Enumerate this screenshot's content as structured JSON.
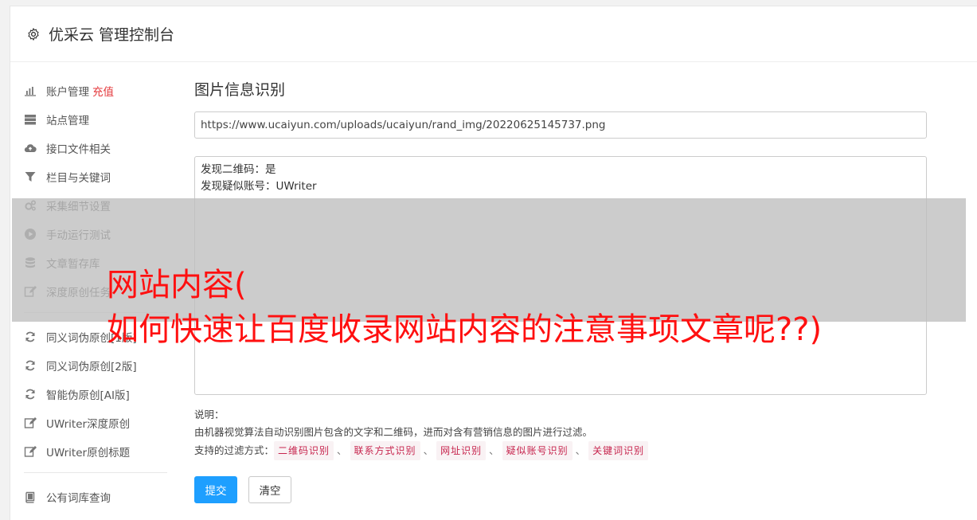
{
  "header": {
    "title": "优采云 管理控制台",
    "icon": "gear-icon"
  },
  "sidebar": {
    "group1": [
      {
        "label": "账户管理",
        "extra": "充值",
        "icon": "bar-chart-icon",
        "name": "account"
      },
      {
        "label": "站点管理",
        "icon": "server-icon",
        "name": "sites"
      },
      {
        "label": "接口文件相关",
        "icon": "cloud-upload-icon",
        "name": "api-files"
      },
      {
        "label": "栏目与关键词",
        "icon": "filter-icon",
        "name": "columns-keywords"
      },
      {
        "label": "采集细节设置",
        "icon": "gears-icon",
        "name": "collect-settings"
      },
      {
        "label": "手动运行测试",
        "icon": "play-circle-icon",
        "name": "manual-test"
      },
      {
        "label": "文章暂存库",
        "icon": "database-icon",
        "name": "article-store"
      },
      {
        "label": "深度原创任务",
        "icon": "edit-icon",
        "name": "deep-original-task"
      }
    ],
    "group2": [
      {
        "label": "同义词伪原创[1版]",
        "icon": "refresh-icon",
        "name": "synonym-v1"
      },
      {
        "label": "同义词伪原创[2版]",
        "icon": "refresh-icon",
        "name": "synonym-v2"
      },
      {
        "label": "智能伪原创[AI版]",
        "icon": "refresh-icon",
        "name": "ai-rewrite"
      },
      {
        "label": "UWriter深度原创",
        "icon": "edit-icon",
        "name": "uwriter-deep"
      },
      {
        "label": "UWriter原创标题",
        "icon": "edit-icon",
        "name": "uwriter-title"
      }
    ],
    "group3": [
      {
        "label": "公有词库查询",
        "icon": "book-icon",
        "name": "public-lexicon"
      }
    ]
  },
  "main": {
    "title": "图片信息识别",
    "url_value": "https://www.ucaiyun.com/uploads/ucaiyun/rand_img/20220625145737.png",
    "result_lines": [
      "发现二维码：是",
      "发现疑似账号：UWriter"
    ],
    "notes_label": "说明：",
    "notes_desc": "由机器视觉算法自动识别图片包含的文字和二维码，进而对含有营销信息的图片进行过滤。",
    "filter_label": "支持的过滤方式：",
    "filter_tags": [
      "二维码识别",
      "联系方式识别",
      "网址识别",
      "疑似账号识别",
      "关键词识别"
    ],
    "tag_separator": "、",
    "submit_label": "提交",
    "clear_label": "清空"
  },
  "overlay": {
    "line1": "网站内容(",
    "line2": "如何快速让百度收录网站内容的注意事项文章呢??)"
  },
  "colors": {
    "accent": "#1e9fff",
    "recharge": "#e4393c",
    "tag_text": "#c7254e",
    "tag_bg": "#f9f2f4",
    "overlay_text": "#ff1010"
  }
}
